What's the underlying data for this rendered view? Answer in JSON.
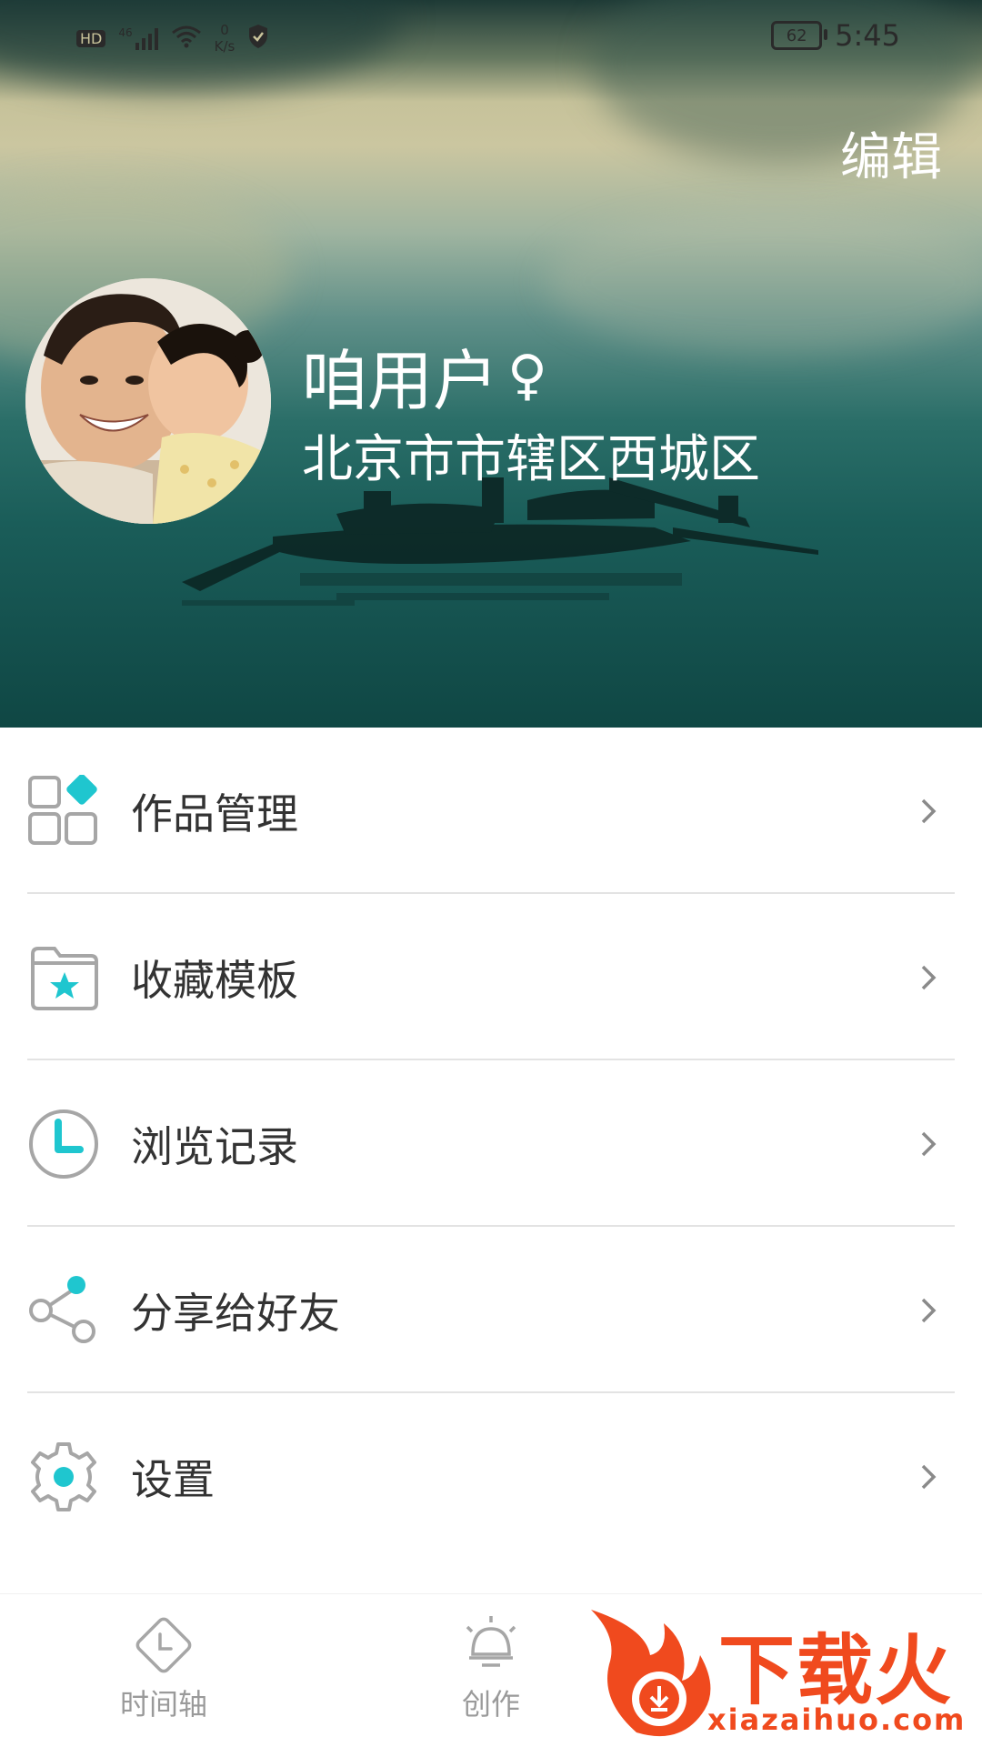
{
  "status_bar": {
    "hd": "HD",
    "signal": "46",
    "speed_value": "0",
    "speed_unit": "K/s",
    "battery": "62",
    "time": "5:45"
  },
  "header": {
    "edit_label": "编辑",
    "username": "咱用户",
    "gender_symbol": "♀",
    "location": "北京市市辖区西城区"
  },
  "menu": [
    {
      "label": "作品管理",
      "icon": "grid-icon"
    },
    {
      "label": "收藏模板",
      "icon": "folder-star-icon"
    },
    {
      "label": "浏览记录",
      "icon": "clock-icon"
    },
    {
      "label": "分享给好友",
      "icon": "share-icon"
    },
    {
      "label": "设置",
      "icon": "gear-icon"
    }
  ],
  "tabs": [
    {
      "label": "时间轴",
      "icon": "timeline-icon"
    },
    {
      "label": "创作",
      "icon": "bulb-icon"
    }
  ],
  "watermark": {
    "brand": "下载火",
    "url": "xiazaihuo.com"
  },
  "colors": {
    "accent": "#1fc6cf",
    "icon_gray": "#a6a6a6",
    "text": "#333333",
    "watermark": "#f04a1e"
  }
}
